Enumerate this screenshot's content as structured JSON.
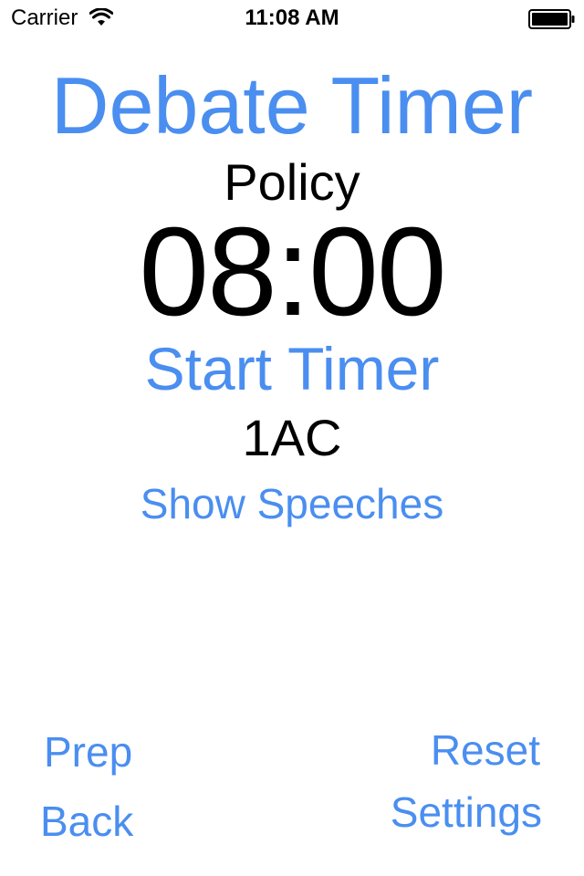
{
  "status_bar": {
    "carrier": "Carrier",
    "time": "11:08 AM",
    "wifi_icon": "wifi-icon",
    "battery_icon": "battery-icon"
  },
  "app": {
    "title": "Debate Timer",
    "format": "Policy",
    "timer": "08:00",
    "start_label": "Start Timer",
    "speech": "1AC",
    "show_speeches_label": "Show Speeches"
  },
  "bottom": {
    "prep_label": "Prep",
    "back_label": "Back",
    "reset_label": "Reset",
    "settings_label": "Settings"
  },
  "colors": {
    "accent": "#4a8ef0",
    "text": "#000000",
    "background": "#ffffff"
  }
}
